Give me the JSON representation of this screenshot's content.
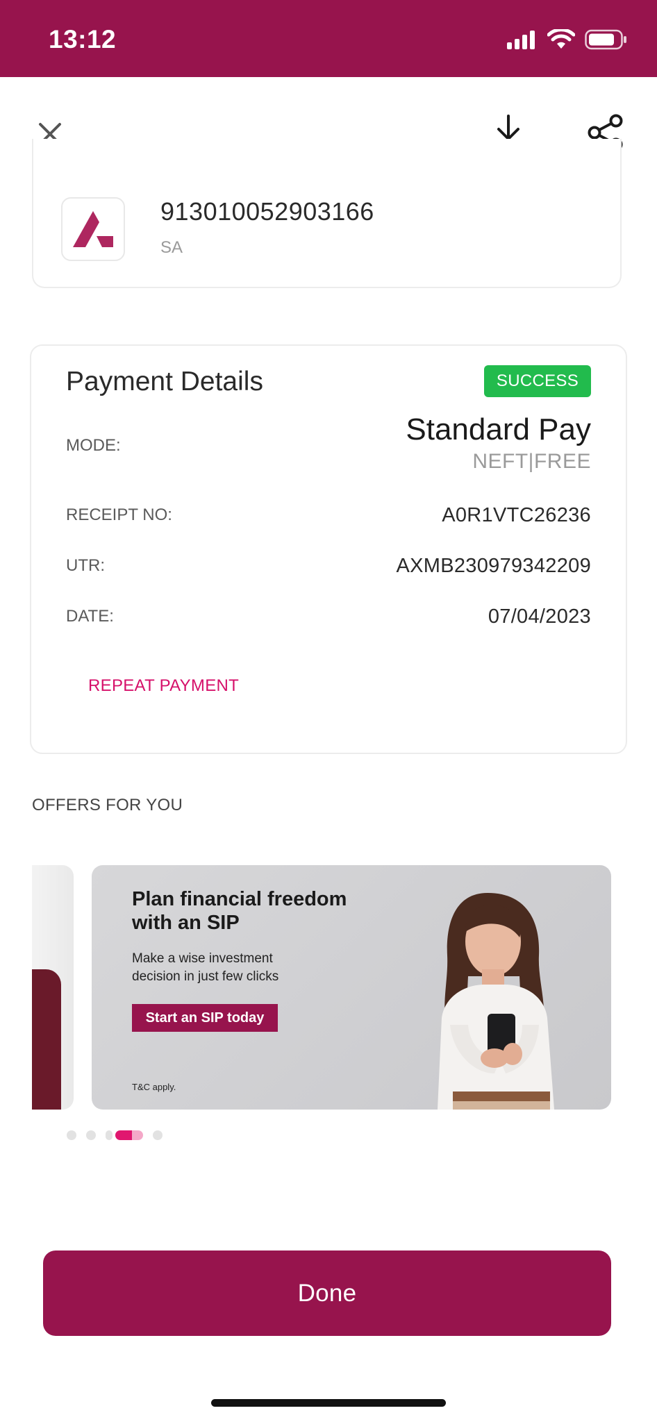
{
  "status_bar": {
    "time": "13:12",
    "icons": [
      "cellular-signal-icon",
      "wifi-icon",
      "battery-icon"
    ],
    "background": "#97144d"
  },
  "top_bar": {
    "icons": [
      "close-icon",
      "download-icon",
      "share-icon"
    ]
  },
  "account": {
    "number": "913010052903166",
    "type": "SA",
    "logo": "axis-bank-logo"
  },
  "payment_details": {
    "title": "Payment Details",
    "status": "SUCCESS",
    "status_color": "#22bb4d",
    "mode_label": "MODE:",
    "mode_value": "Standard Pay",
    "mode_sub": "NEFT|FREE",
    "receipt_label": "RECEIPT NO:",
    "receipt_value": "A0R1VTC26236",
    "utr_label": "UTR:",
    "utr_value": "AXMB230979342209",
    "date_label": "DATE:",
    "date_value": "07/04/2023",
    "repeat_label": "REPEAT PAYMENT"
  },
  "offers": {
    "title": "OFFERS FOR YOU",
    "banner": {
      "headline": "Plan financial freedom with an SIP",
      "subtext": "Make a wise investment decision in just few clicks",
      "cta": "Start an SIP today",
      "tc": "T&C apply."
    },
    "carousel_count": 5,
    "carousel_active": 4
  },
  "done_button": {
    "label": "Done"
  },
  "colors": {
    "brand": "#97144d",
    "accent": "#d6106a"
  }
}
